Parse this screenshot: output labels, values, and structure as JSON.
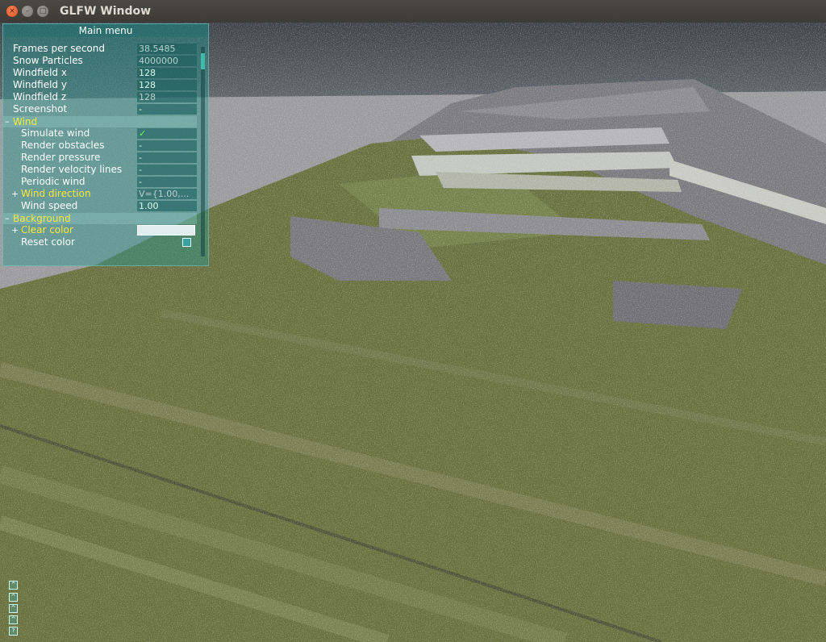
{
  "window": {
    "title": "GLFW Window",
    "close_glyph": "×",
    "min_glyph": "–",
    "max_glyph": "□"
  },
  "panel": {
    "title": "Main menu",
    "rows": [
      {
        "label": "Frames per second",
        "value": "38.5485"
      },
      {
        "label": "Snow Particles",
        "value": "4000000"
      },
      {
        "label": "Windfield x",
        "value": "128"
      },
      {
        "label": "Windfield y",
        "value": "128"
      },
      {
        "label": "Windfield z",
        "value": "128"
      },
      {
        "label": "Screenshot",
        "value": "-"
      }
    ],
    "wind_group": {
      "sign": "–",
      "label": "Wind"
    },
    "wind_rows": [
      {
        "label": "Simulate wind",
        "value": "✓"
      },
      {
        "label": "Render obstacles",
        "value": "-"
      },
      {
        "label": "Render pressure",
        "value": "-"
      },
      {
        "label": "Render velocity lines",
        "value": "-"
      },
      {
        "label": "Periodic wind",
        "value": "-"
      }
    ],
    "wind_direction": {
      "sign": "+",
      "label": "Wind direction",
      "value": "V={1.00,..."
    },
    "wind_speed": {
      "label": "Wind speed",
      "value": "1.00"
    },
    "background_group": {
      "sign": "–",
      "label": "Background"
    },
    "clear_color": {
      "sign": "+",
      "label": "Clear color",
      "color": "#e1eef0"
    },
    "reset_color": {
      "label": "Reset color"
    }
  },
  "minimized_bars": [
    "^",
    "^",
    "^",
    "^",
    "?"
  ],
  "colors": {
    "accent": "#ffea3a",
    "panel": "#289691",
    "grass": "#6b7340",
    "snow": "#a9a9a9"
  }
}
